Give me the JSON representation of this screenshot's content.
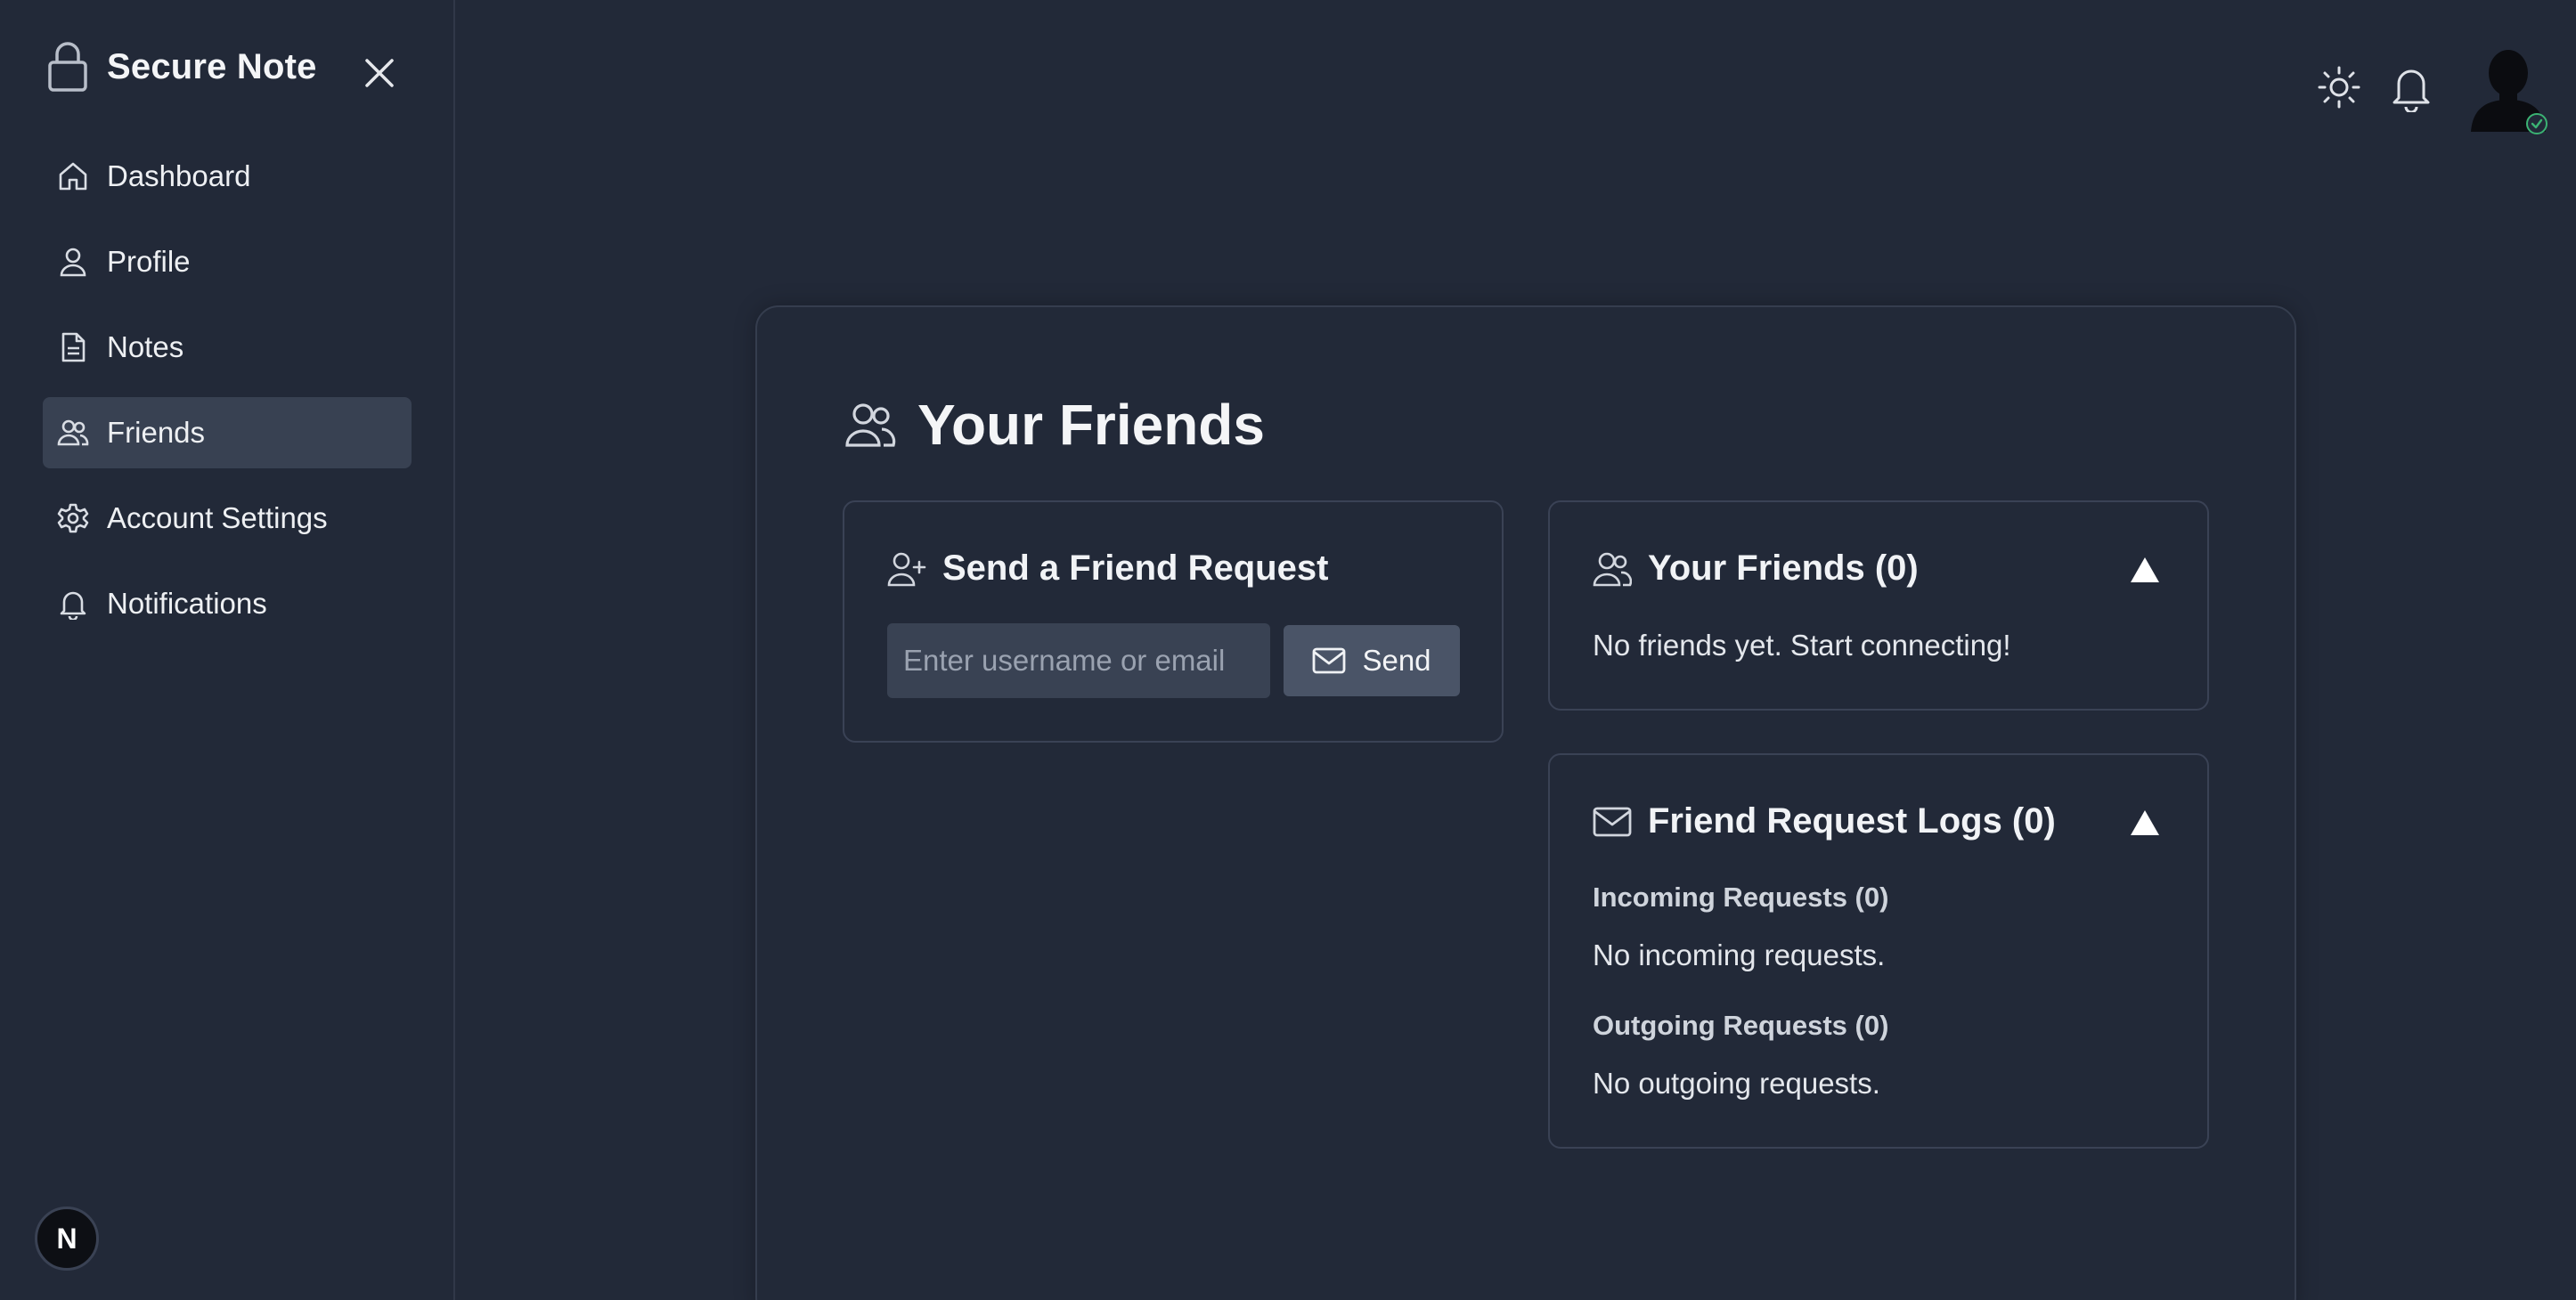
{
  "app": {
    "title": "Secure Note"
  },
  "sidebar": {
    "items": [
      {
        "label": "Dashboard",
        "icon": "home-icon"
      },
      {
        "label": "Profile",
        "icon": "user-icon"
      },
      {
        "label": "Notes",
        "icon": "file-icon"
      },
      {
        "label": "Friends",
        "icon": "users-icon",
        "active": true
      },
      {
        "label": "Account Settings",
        "icon": "gear-icon"
      },
      {
        "label": "Notifications",
        "icon": "bell-icon"
      }
    ],
    "badge": "N"
  },
  "page": {
    "title": "Your Friends"
  },
  "send_request": {
    "title": "Send a Friend Request",
    "placeholder": "Enter username or email",
    "button_label": "Send"
  },
  "friends_panel": {
    "title": "Your Friends (0)",
    "empty_text": "No friends yet. Start connecting!"
  },
  "logs_panel": {
    "title": "Friend Request Logs (0)",
    "incoming_title": "Incoming Requests (0)",
    "incoming_empty": "No incoming requests.",
    "outgoing_title": "Outgoing Requests (0)",
    "outgoing_empty": "No outgoing requests."
  },
  "colors": {
    "background": "#222938",
    "active_nav": "#384152",
    "status_online": "#3bb273"
  }
}
